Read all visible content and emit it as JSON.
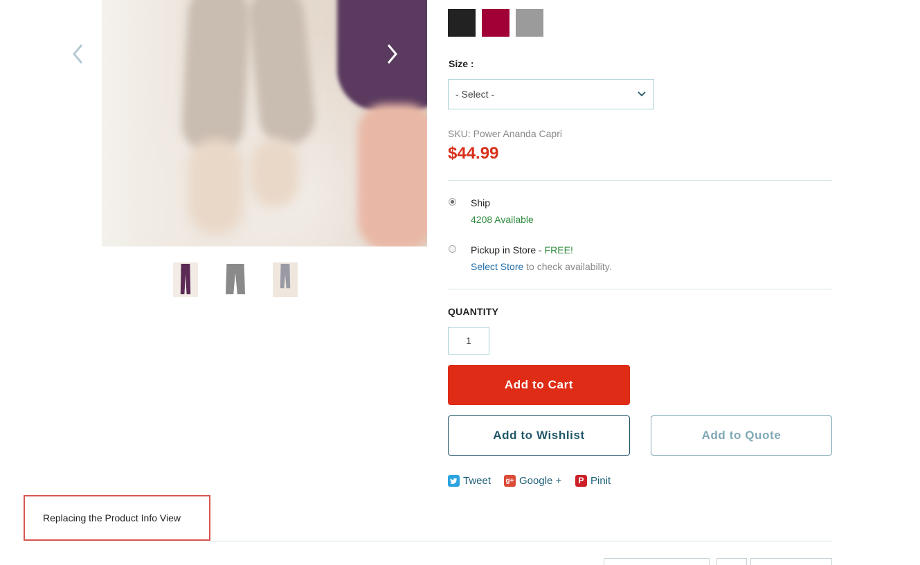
{
  "gallery": {
    "prev_icon": "chevron-left-icon",
    "next_icon": "chevron-right-icon",
    "thumbnails": [
      {
        "alt": "purple capri"
      },
      {
        "alt": "grey pants"
      },
      {
        "alt": "grey capri"
      }
    ]
  },
  "colors": [
    {
      "name": "black",
      "hex": "#222222"
    },
    {
      "name": "burgundy",
      "hex": "#a00035"
    },
    {
      "name": "grey",
      "hex": "#9b9b9b"
    }
  ],
  "size": {
    "label": "Size :",
    "selected": "- Select -"
  },
  "sku": "SKU: Power Ananda Capri",
  "price": "$44.99",
  "fulfillment": {
    "ship_label": "Ship",
    "ship_available": "4208 Available",
    "pickup_label": "Pickup in Store - ",
    "pickup_free": "FREE!",
    "select_store_link": "Select Store",
    "select_store_rest": " to check availability."
  },
  "quantity": {
    "label": "QUANTITY",
    "value": "1"
  },
  "buttons": {
    "add_to_cart": "Add to Cart",
    "add_to_wishlist": "Add to Wishlist",
    "add_to_quote": "Add to Quote"
  },
  "social": {
    "tweet": "Tweet",
    "google": "Google +",
    "pinit": "Pinit"
  },
  "notice": "Replacing the Product Info View"
}
